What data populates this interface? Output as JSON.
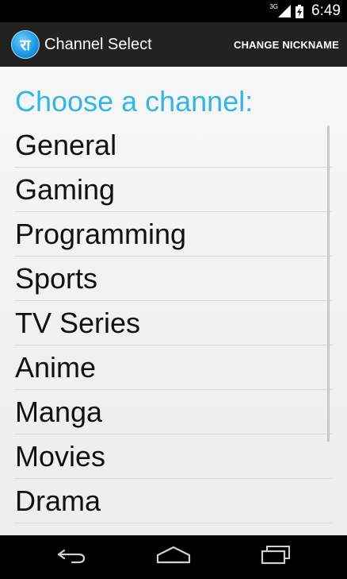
{
  "status_bar": {
    "network_type": "3G",
    "time": "6:49"
  },
  "action_bar": {
    "app_icon_glyph": "रा",
    "title": "Channel Select",
    "change_nickname_label": "CHANGE NICKNAME"
  },
  "main": {
    "heading": "Choose a channel:",
    "channels": [
      {
        "label": "General"
      },
      {
        "label": "Gaming"
      },
      {
        "label": "Programming"
      },
      {
        "label": "Sports"
      },
      {
        "label": "TV Series"
      },
      {
        "label": "Anime"
      },
      {
        "label": "Manga"
      },
      {
        "label": "Movies"
      },
      {
        "label": "Drama"
      }
    ]
  },
  "nav_bar": {
    "icons": [
      "back-icon",
      "home-icon",
      "recents-icon"
    ]
  },
  "colors": {
    "accent": "#33b5e5",
    "action_bar": "#222222",
    "status_bar": "#000000"
  }
}
